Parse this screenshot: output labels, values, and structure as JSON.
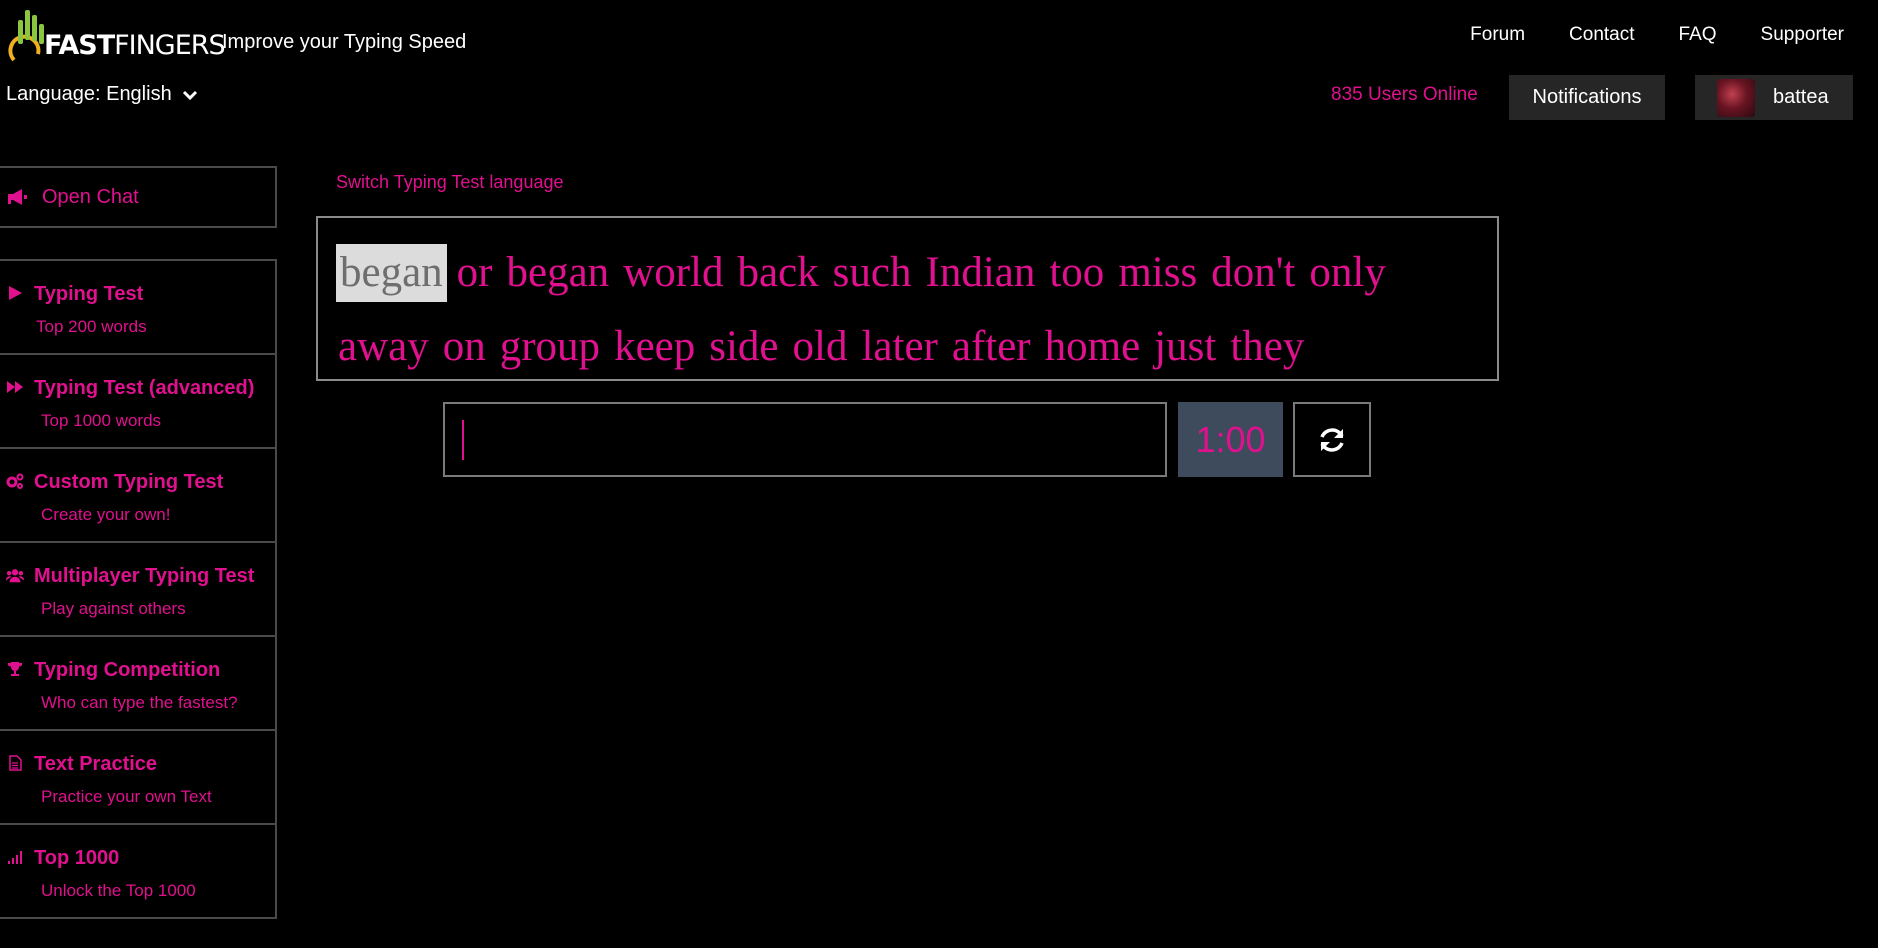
{
  "header": {
    "logo_bold": "FAST",
    "logo_thin": "FINGERS",
    "tagline": "Improve your Typing Speed",
    "nav": [
      "Forum",
      "Contact",
      "FAQ",
      "Supporter"
    ],
    "language_label": "Language: English",
    "users_online": "835 Users Online",
    "notifications": "Notifications",
    "username": "battea"
  },
  "sidebar": {
    "open_chat": "Open Chat",
    "items": [
      {
        "title": "Typing Test",
        "sub": "Top 200 words",
        "icon": "play-icon"
      },
      {
        "title": "Typing Test (advanced)",
        "sub": "Top 1000 words",
        "icon": "fast-forward-icon"
      },
      {
        "title": "Custom Typing Test",
        "sub": "Create your own!",
        "icon": "gears-icon"
      },
      {
        "title": "Multiplayer Typing Test",
        "sub": "Play against others",
        "icon": "users-icon"
      },
      {
        "title": "Typing Competition",
        "sub": "Who can type the fastest?",
        "icon": "trophy-icon"
      },
      {
        "title": "Text Practice",
        "sub": "Practice your own Text",
        "icon": "document-icon"
      },
      {
        "title": "Top 1000",
        "sub": "Unlock the Top 1000",
        "icon": "signal-icon"
      }
    ]
  },
  "main": {
    "switch_language": "Switch Typing Test language",
    "words": [
      "began",
      "or",
      "began",
      "world",
      "back",
      "such",
      "Indian",
      "too",
      "miss",
      "don't",
      "only",
      "away",
      "on",
      "group",
      "keep",
      "side",
      "old",
      "later",
      "after",
      "home",
      "just",
      "they"
    ],
    "current_word_index": 0,
    "timer": "1:00"
  },
  "colors": {
    "accent": "#e0108f",
    "background": "#000000",
    "timer_bg": "#3d4b5c",
    "button_bg": "#262626"
  }
}
